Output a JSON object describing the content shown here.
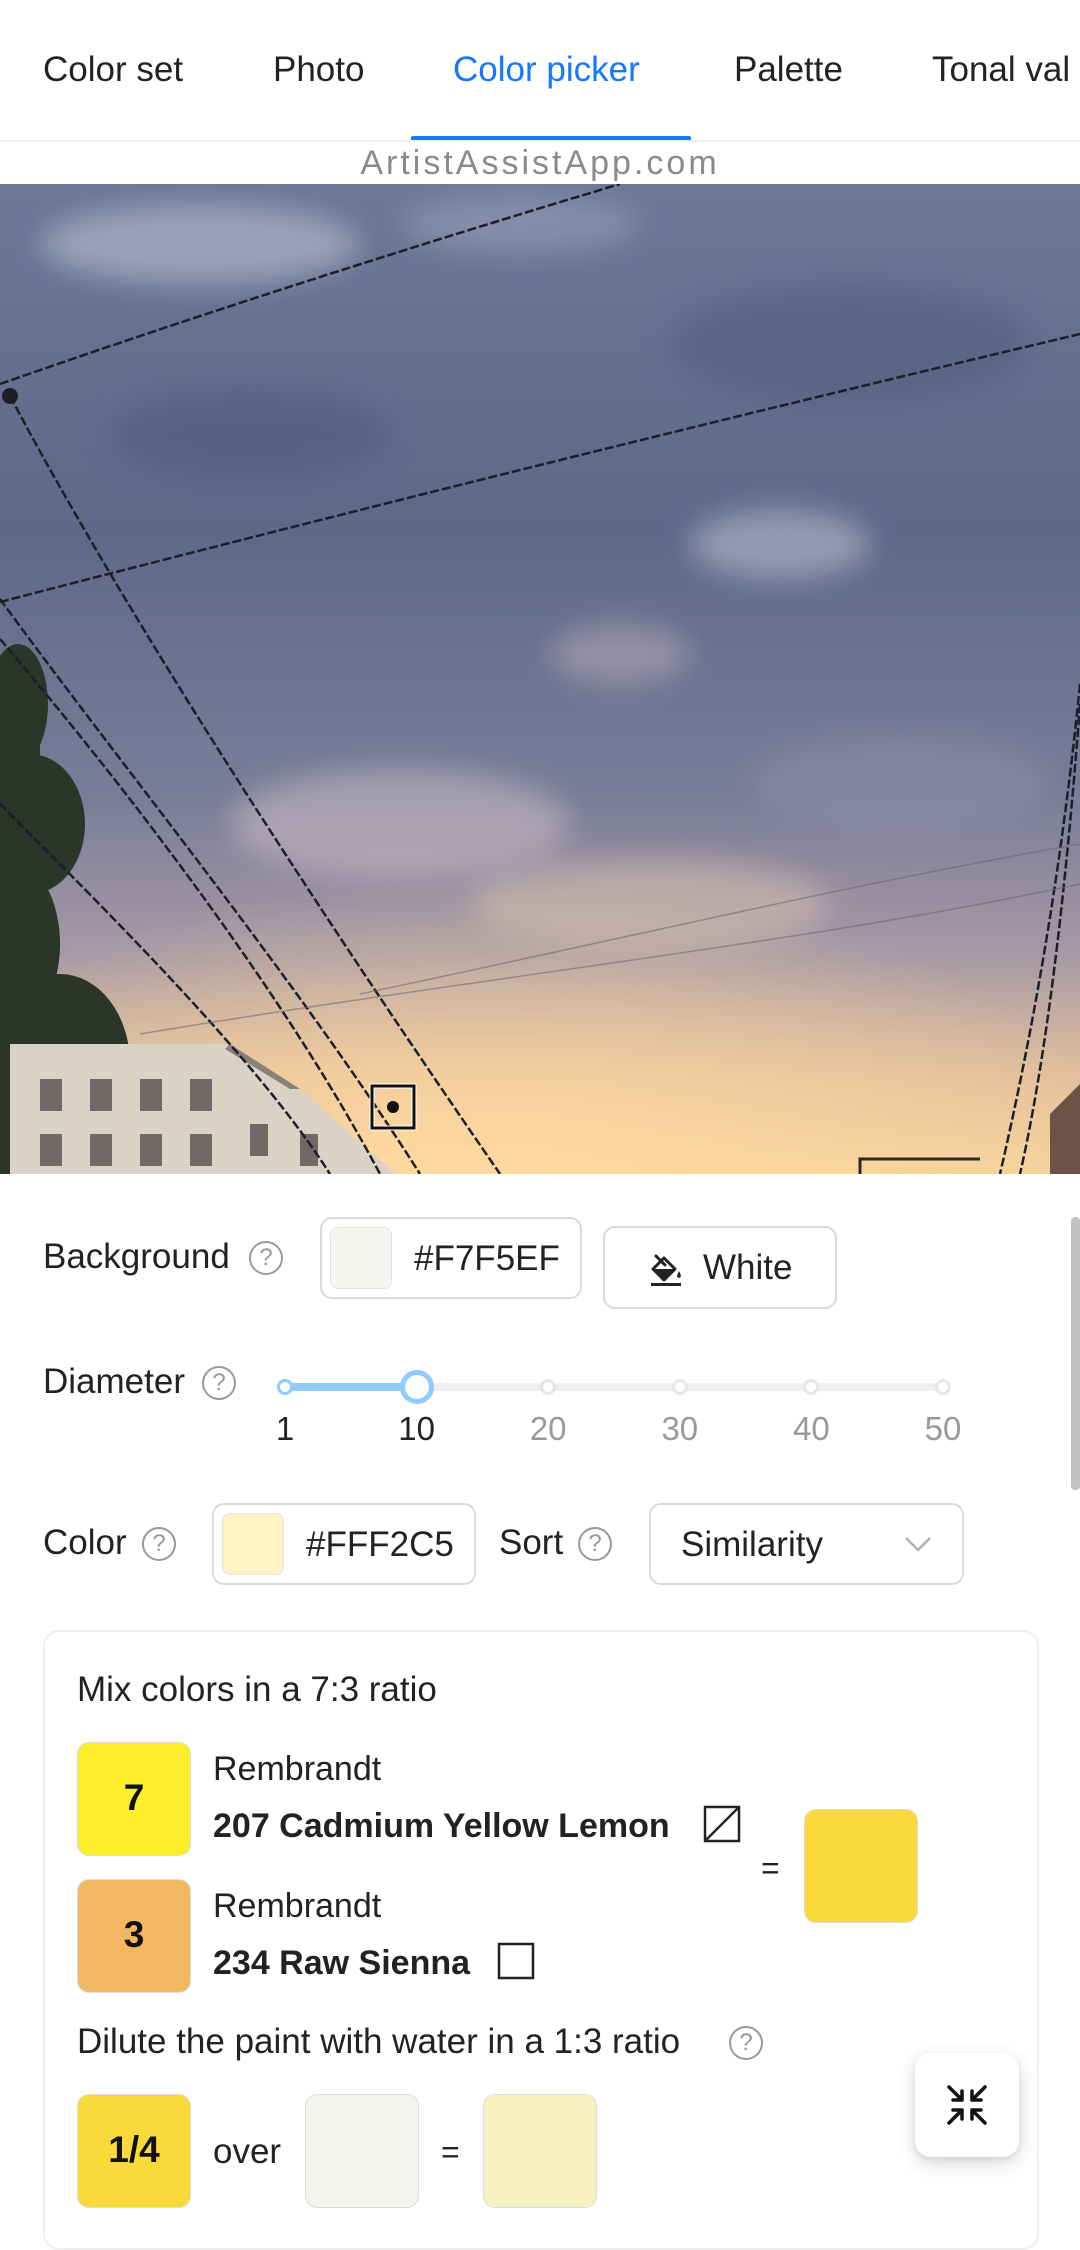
{
  "tabs": [
    {
      "label": "Color set",
      "active": false
    },
    {
      "label": "Photo",
      "active": false
    },
    {
      "label": "Color picker",
      "active": true
    },
    {
      "label": "Palette",
      "active": false
    },
    {
      "label": "Tonal val",
      "active": false
    }
  ],
  "watermark": "ArtistAssistApp.com",
  "photo": {
    "description_icon": "sky-photo",
    "picker_icon": "target-icon"
  },
  "background": {
    "label": "Background",
    "hex": "#F7F5EF",
    "swatch_color": "#F7F5EF",
    "white_button_label": "White",
    "white_button_icon": "paint-bucket-icon"
  },
  "diameter": {
    "label": "Diameter",
    "marks": [
      "1",
      "10",
      "20",
      "30",
      "40",
      "50"
    ],
    "value": 10,
    "min": 1,
    "max": 50
  },
  "color": {
    "label": "Color",
    "hex": "#FFF2C5",
    "swatch_color": "#FFF2C5"
  },
  "sort": {
    "label": "Sort",
    "selected": "Similarity"
  },
  "mix": {
    "title": "Mix colors in a 7:3 ratio",
    "paints": [
      {
        "parts": "7",
        "color": "#FCEE2A",
        "brand": "Rembrandt",
        "name": "207 Cadmium Yellow Lemon",
        "opacity_icon": "semi-transparent-square-icon"
      },
      {
        "parts": "3",
        "color": "#F2B761",
        "brand": "Rembrandt",
        "name": "234 Raw Sienna",
        "opacity_icon": "transparent-square-icon"
      }
    ],
    "equals": "=",
    "result_color": "#F9DA3A"
  },
  "dilute": {
    "title": "Dilute the paint with water in a 1:3 ratio",
    "fraction": "1/4",
    "fraction_color": "#F9DA3A",
    "over_label": "over",
    "background_color": "#F4F3EE",
    "equals": "=",
    "result_color": "#F7F1C2"
  },
  "fab_icon": "compress-icon"
}
